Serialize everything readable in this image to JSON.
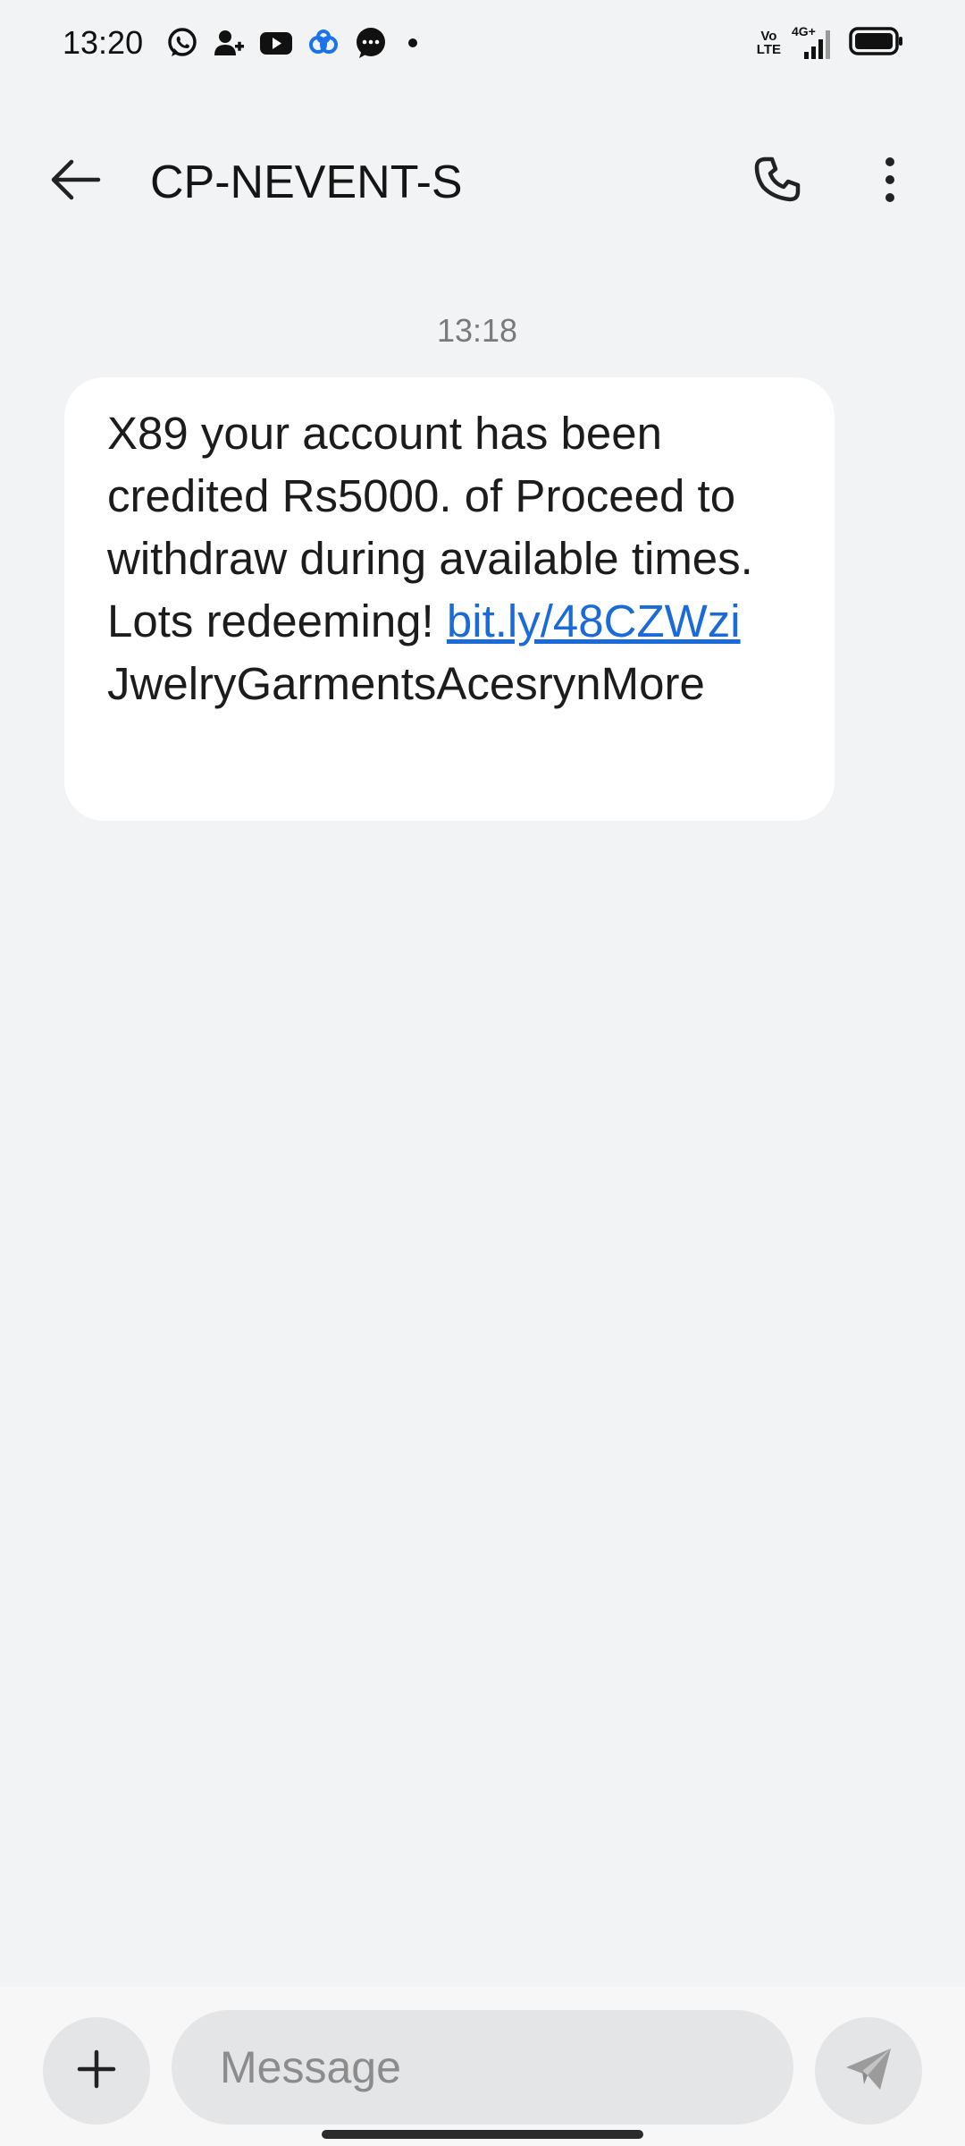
{
  "status_bar": {
    "time": "13:20",
    "left_icons": [
      "whatsapp-icon",
      "contact-add-icon",
      "youtube-icon",
      "cloud-app-icon",
      "message-bubble-icon",
      "dot-icon"
    ],
    "volte_line1": "Vo",
    "volte_line2": "LTE",
    "network": "4G+",
    "right_icons": [
      "volte-icon",
      "signal-icon",
      "battery-icon"
    ]
  },
  "header": {
    "title": "CP-NEVENT-S",
    "back_icon": "arrow-left-icon",
    "call_icon": "phone-icon",
    "more_icon": "more-vertical-icon"
  },
  "conversation": {
    "timestamp": "13:18",
    "message": {
      "text_before_link": "X89 your account has been credited Rs5000. of Proceed to withdraw during available times. Lots redeeming! ",
      "link_text": "bit.ly/48CZWzi",
      "text_after_link": "JwelryGarmentsAcesrynMore"
    }
  },
  "composer": {
    "placeholder": "Message",
    "attach_icon": "plus-icon",
    "send_icon": "send-icon"
  },
  "colors": {
    "background": "#f2f3f5",
    "bubble": "#ffffff",
    "link": "#1a6ad8",
    "input_bg": "#e4e5e7"
  }
}
